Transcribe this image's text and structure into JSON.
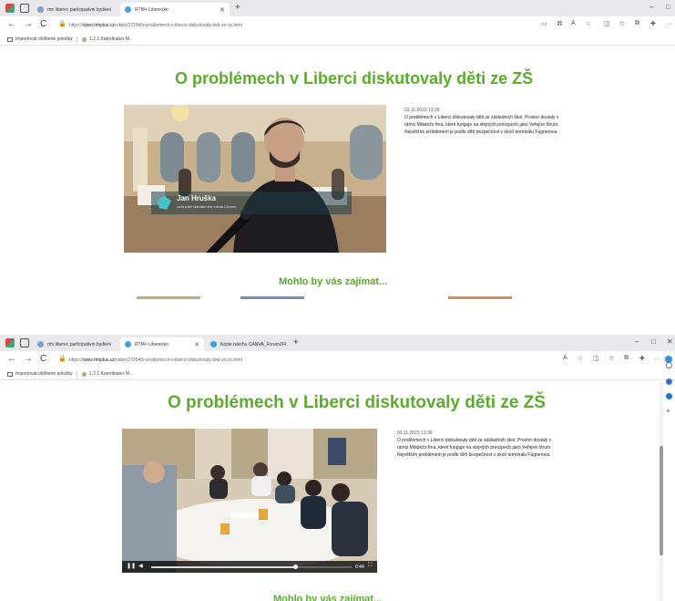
{
  "shot1": {
    "tabs": [
      {
        "label": "rtm liberec participativni bydleni"
      },
      {
        "label": "RTM+ Liberecko"
      }
    ],
    "new_tab": "+",
    "window_controls": {
      "minimize": "–",
      "restore": "□"
    },
    "address": {
      "prefix": "https://",
      "host": "www.rtmplus.cz",
      "path": "/video/27254/o-problemech-v-liberci-diskutovaly-deti-ze-zs.html"
    },
    "nav": {
      "back": "←",
      "forward": "→",
      "reload": "C"
    },
    "favorites": [
      {
        "label": "Importovat oblíbené položky"
      },
      {
        "label": "1.2.1 Koordinátor M..."
      }
    ],
    "page": {
      "headline": "O problémech v Liberci diskutovaly děti ze ZŠ",
      "date": "03.11.2023 13:39",
      "body": "O problémech v Liberci diskutovaly děti ze základních škol. Prostor dostaly v rámci Mládežo fóra, které funguje na stejných principech jako Veřejné fórum. Největším problémem je podle dětí bezpečnost v okolí terminálu Fügnerova.",
      "speaker_name": "Jan Hruška",
      "speaker_title": "zastupitel statutárního města Liberec",
      "more": "Mohlo by vás zajímat..."
    }
  },
  "shot2": {
    "tabs": [
      {
        "label": "rtm liberec participativni bydleni"
      },
      {
        "label": "RTM+ Liberecko"
      },
      {
        "label": "Kopie návrhu CANVA_ForumZFt"
      }
    ],
    "new_tab": "+",
    "window_controls": {
      "minimize": "–",
      "restore": "□",
      "close": "✕"
    },
    "address": {
      "prefix": "https://",
      "host": "www.rtmplus.cz",
      "path": "/video/27254/o-problemech-v-liberci-diskutovaly-deti-ze-zs.html"
    },
    "nav": {
      "back": "←",
      "forward": "→",
      "reload": "C"
    },
    "favorites": [
      {
        "label": "Importovat oblíbené položky"
      },
      {
        "label": "1.2.1 Koordinátor M..."
      }
    ],
    "page": {
      "headline": "O problémech v Liberci diskutovaly děti ze ZŠ",
      "date": "03.11.2023 13:39",
      "body": "O problémech v Liberci diskutovaly děti ze základních škol. Prostor dostaly v rámci Mládežo fóra, které funguje na stejných principech jako Veřejné fórum. Největším problémem je podle dětí bezpečnost v okolí terminálu Fügnerova.",
      "time": "0:44",
      "progress": 0.72,
      "more": "Mohlo by vás zajímat..."
    }
  },
  "colors": {
    "accent_green": "#5bab2d",
    "tab_bar": "#e9e9ec"
  },
  "icons": [
    "edge-logo-icon",
    "tab-actions-icon",
    "lock-icon",
    "read-aloud-icon",
    "favorite-star-icon",
    "collections-icon",
    "extensions-icon",
    "more-icon",
    "play-icon",
    "volume-icon",
    "fullscreen-icon",
    "folder-icon"
  ]
}
